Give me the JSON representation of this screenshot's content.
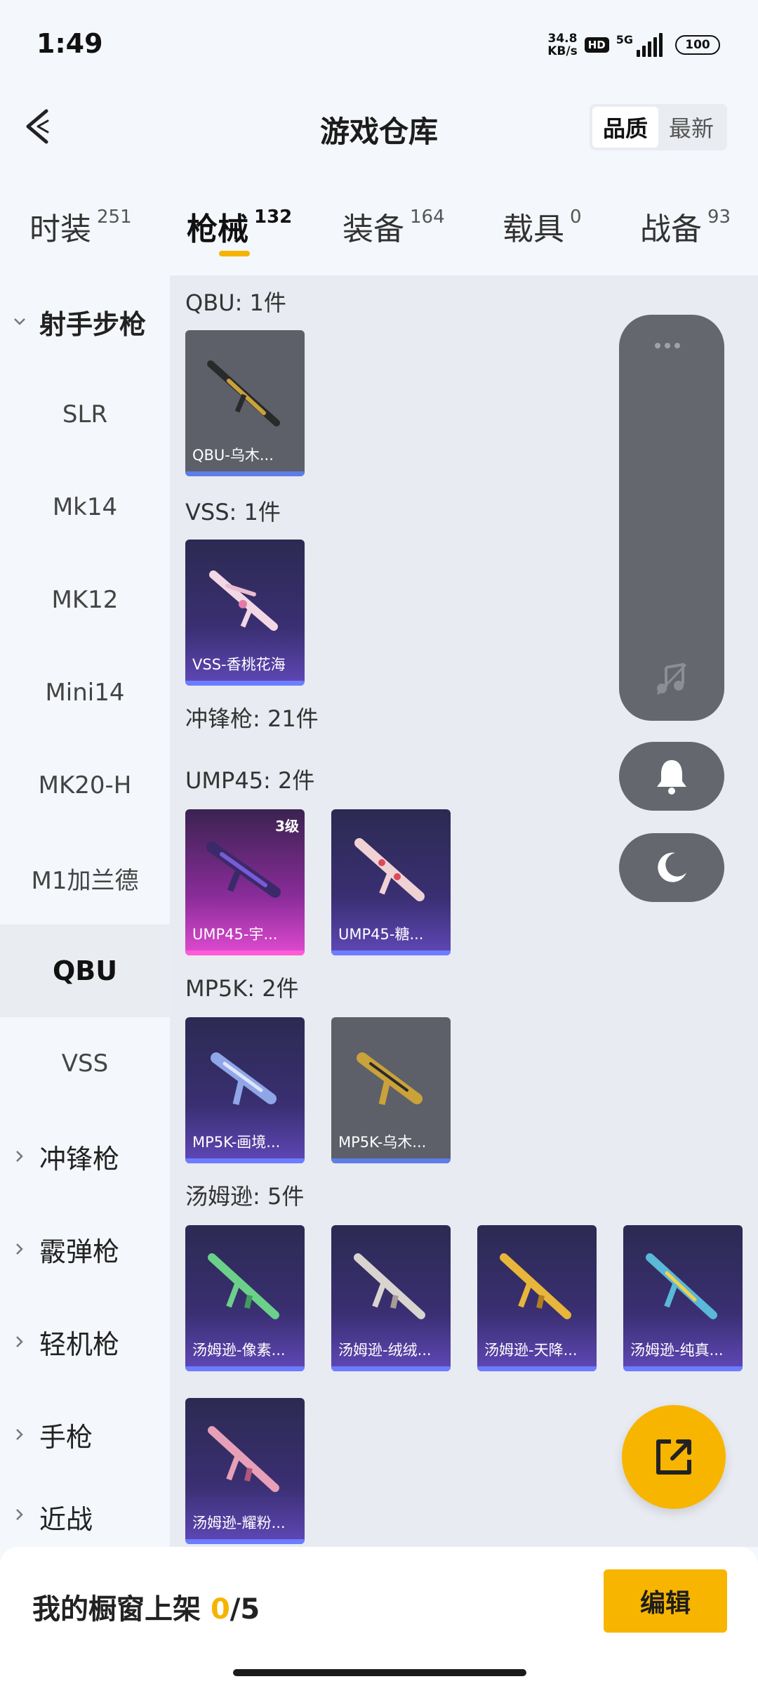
{
  "status_bar": {
    "time": "1:49",
    "net_speed_value": "34.8",
    "net_speed_unit": "KB/s",
    "hd": "HD",
    "network": "5G",
    "battery": "100"
  },
  "header": {
    "title": "游戏仓库",
    "sort_options": [
      "品质",
      "最新"
    ],
    "sort_selected": "品质"
  },
  "category_tabs": [
    {
      "label": "时装",
      "count": "251"
    },
    {
      "label": "枪械",
      "count": "132",
      "active": true
    },
    {
      "label": "装备",
      "count": "164"
    },
    {
      "label": "载具",
      "count": "0"
    },
    {
      "label": "战备",
      "count": "93"
    }
  ],
  "sidebar": {
    "items": [
      {
        "label": "射手步枪",
        "type": "group-expanded"
      },
      {
        "label": "SLR"
      },
      {
        "label": "Mk14"
      },
      {
        "label": "MK12"
      },
      {
        "label": "Mini14"
      },
      {
        "label": "MK20-H"
      },
      {
        "label": "M1加兰德"
      },
      {
        "label": "QBU",
        "selected": true
      },
      {
        "label": "VSS"
      },
      {
        "label": "冲锋枪",
        "type": "group"
      },
      {
        "label": "霰弹枪",
        "type": "group"
      },
      {
        "label": "轻机枪",
        "type": "group"
      },
      {
        "label": "手枪",
        "type": "group"
      },
      {
        "label": "近战",
        "type": "group"
      }
    ]
  },
  "content": {
    "sections": [
      {
        "title": "QBU: 1件",
        "items": [
          {
            "name": "QBU-乌木...",
            "style": "gray"
          }
        ]
      },
      {
        "title": "VSS: 1件",
        "items": [
          {
            "name": "VSS-香桃花海",
            "style": "purple"
          }
        ]
      },
      {
        "title": "冲锋枪: 21件",
        "items": []
      },
      {
        "title": "UMP45: 2件",
        "items": [
          {
            "name": "UMP45-宇...",
            "style": "pink",
            "level": "3级"
          },
          {
            "name": "UMP45-糖...",
            "style": "purple"
          }
        ]
      },
      {
        "title": "MP5K: 2件",
        "items": [
          {
            "name": "MP5K-画境...",
            "style": "purple"
          },
          {
            "name": "MP5K-乌木...",
            "style": "gray"
          }
        ]
      },
      {
        "title": "汤姆逊: 5件",
        "items": [
          {
            "name": "汤姆逊-像素...",
            "style": "purple"
          },
          {
            "name": "汤姆逊-绒绒...",
            "style": "purple"
          },
          {
            "name": "汤姆逊-天降...",
            "style": "purple"
          },
          {
            "name": "汤姆逊-纯真...",
            "style": "purple"
          },
          {
            "name": "汤姆逊-耀粉...",
            "style": "purple"
          }
        ]
      }
    ]
  },
  "floating": {
    "icons": [
      "more-dots-icon",
      "music-off-icon",
      "bell-icon",
      "moon-icon",
      "share-external-icon"
    ]
  },
  "bottom_bar": {
    "shelf_label": "我的橱窗上架",
    "shelf_current": "0",
    "shelf_total": "/5",
    "edit_label": "编辑"
  },
  "colors": {
    "accent": "#f7b500",
    "content_bg": "#e8ebf1",
    "float_panel": "#64676e"
  }
}
